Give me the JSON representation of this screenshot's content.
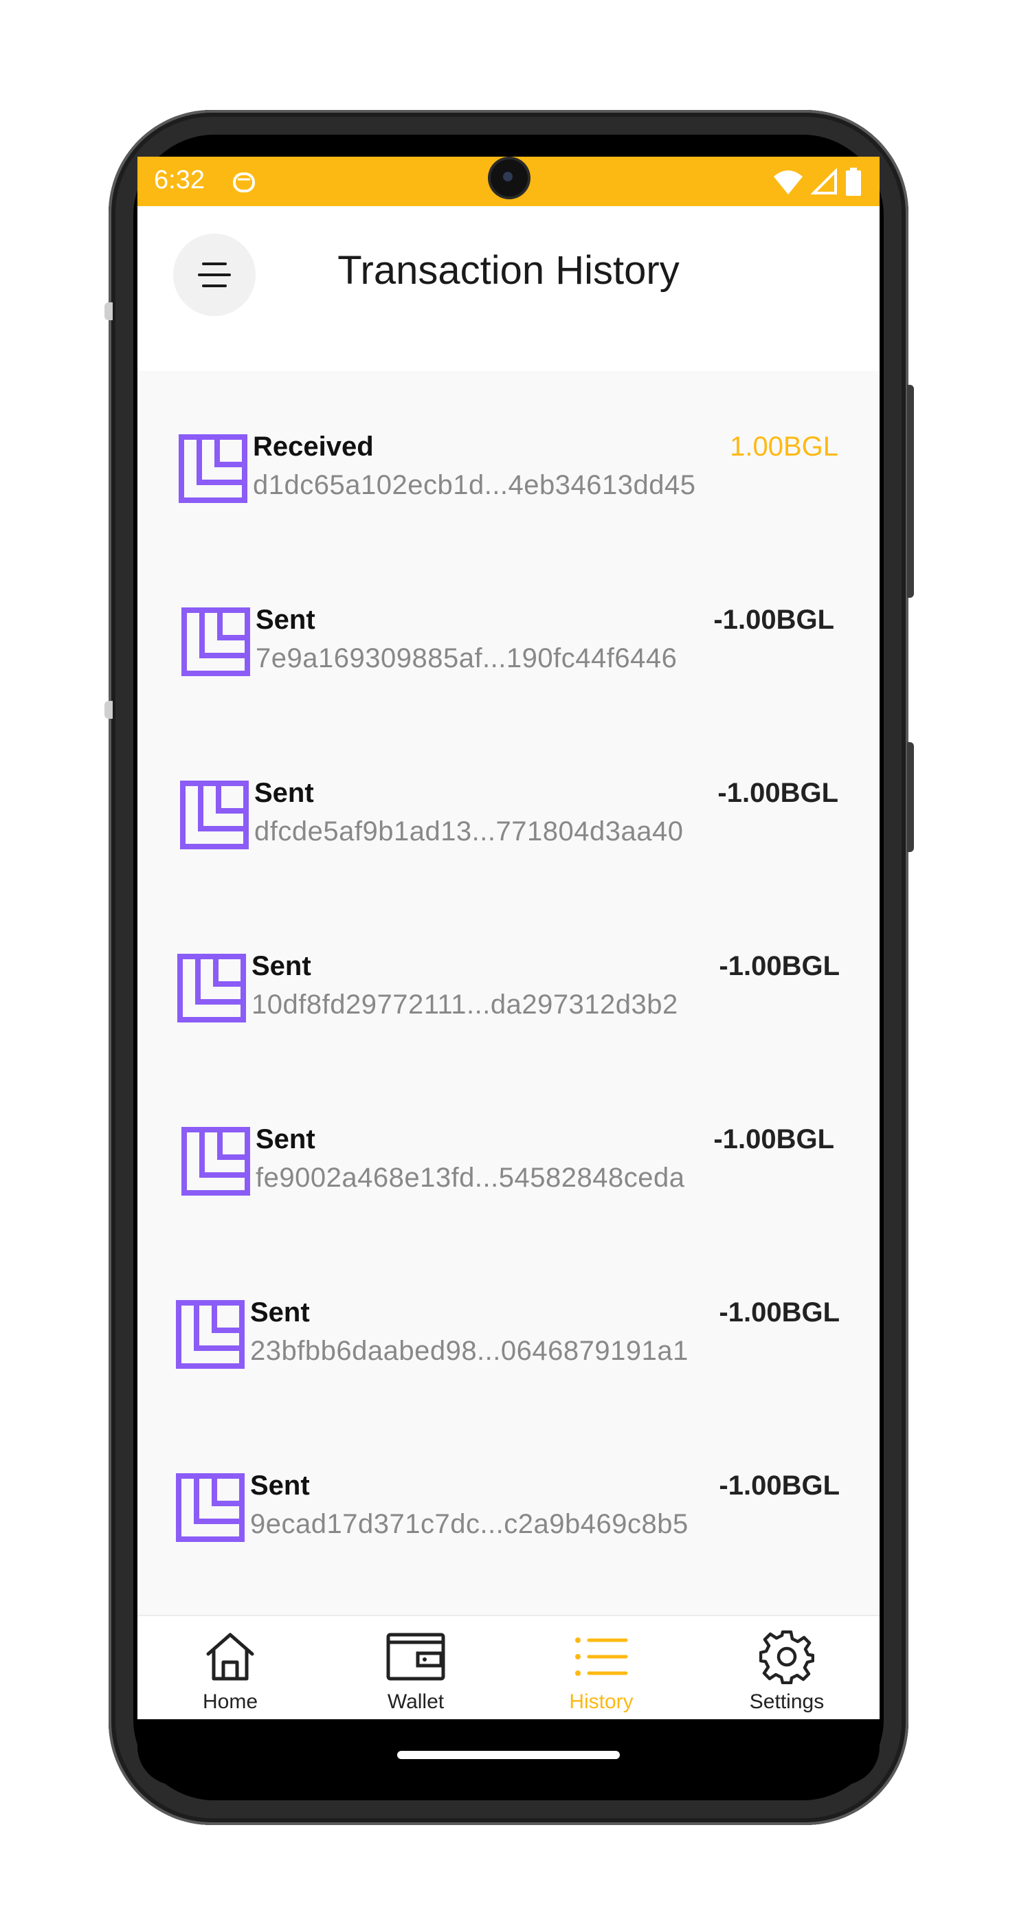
{
  "status_bar": {
    "time": "6:32"
  },
  "header": {
    "title": "Transaction History"
  },
  "transactions": [
    {
      "type": "Received",
      "hash": "d1dc65a102ecb1d...4eb34613dd45",
      "amount": "1.00BGL",
      "direction": "received"
    },
    {
      "type": "Sent",
      "hash": "7e9a169309885af...190fc44f6446",
      "amount": "-1.00BGL",
      "direction": "sent"
    },
    {
      "type": "Sent",
      "hash": "dfcde5af9b1ad13...771804d3aa40",
      "amount": "-1.00BGL",
      "direction": "sent"
    },
    {
      "type": "Sent",
      "hash": "10df8fd29772111...da297312d3b2",
      "amount": "-1.00BGL",
      "direction": "sent"
    },
    {
      "type": "Sent",
      "hash": "fe9002a468e13fd...54582848ceda",
      "amount": "-1.00BGL",
      "direction": "sent"
    },
    {
      "type": "Sent",
      "hash": "23bfbb6daabed98...0646879191a1",
      "amount": "-1.00BGL",
      "direction": "sent"
    },
    {
      "type": "Sent",
      "hash": "9ecad17d371c7dc...c2a9b469c8b5",
      "amount": "-1.00BGL",
      "direction": "sent"
    }
  ],
  "bottom_nav": {
    "items": [
      {
        "label": "Home",
        "icon": "home-icon",
        "active": false
      },
      {
        "label": "Wallet",
        "icon": "wallet-icon",
        "active": false
      },
      {
        "label": "History",
        "icon": "list-icon",
        "active": true
      },
      {
        "label": "Settings",
        "icon": "gear-icon",
        "active": false
      }
    ]
  },
  "colors": {
    "accent": "#FDB913",
    "logo_purple": "#8B5CF6",
    "hash_text": "#888888",
    "content_bg": "#F9F9F9"
  }
}
